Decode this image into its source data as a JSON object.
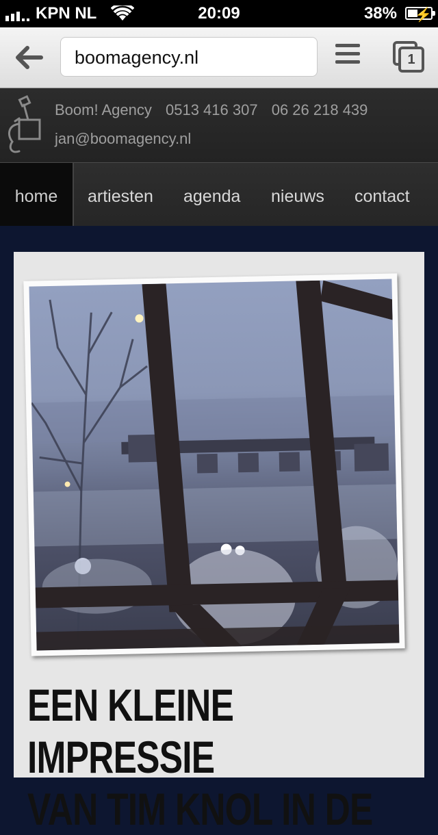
{
  "status_bar": {
    "carrier": "KPN NL",
    "time": "20:09",
    "battery": "38%"
  },
  "browser": {
    "url": "boomagency.nl",
    "tab_count": "1"
  },
  "header": {
    "company": "Boom! Agency",
    "phone1": "0513 416 307",
    "phone2": "06 26 218 439",
    "email": "jan@boomagency.nl"
  },
  "nav": {
    "items": [
      {
        "label": "home",
        "active": true
      },
      {
        "label": "artiesten"
      },
      {
        "label": "agenda"
      },
      {
        "label": "nieuws"
      },
      {
        "label": "contact"
      }
    ]
  },
  "article": {
    "headline_line1": "EEN KLEINE IMPRESSIE",
    "headline_line2": "VAN TIM KNOL IN DE"
  },
  "colors": {
    "page_background": "#0d1630",
    "header_background": "#2a2a2a",
    "nav_active": "#0b0b0b",
    "card_background": "#e6e6e6"
  },
  "icons": [
    "signal-icon",
    "wifi-icon",
    "battery-icon",
    "back-arrow-icon",
    "menu-icon",
    "tabs-icon",
    "plunger-logo-icon"
  ]
}
